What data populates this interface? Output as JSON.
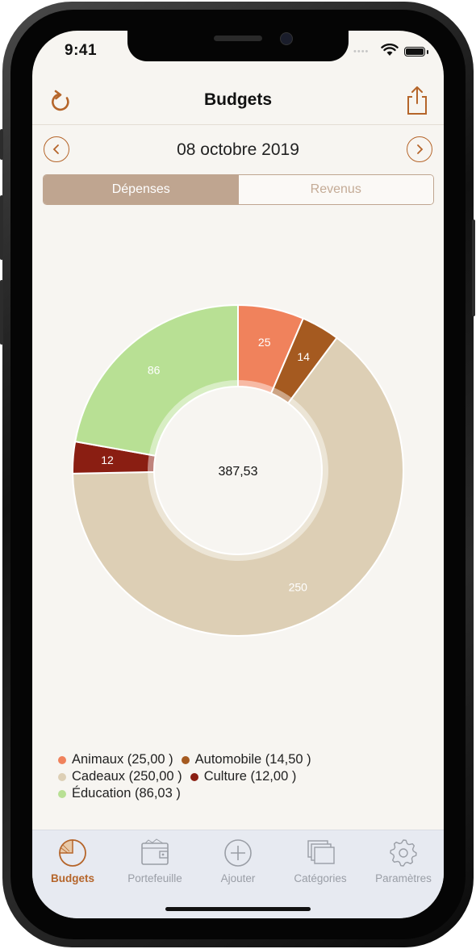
{
  "status_bar": {
    "time": "9:41"
  },
  "navbar": {
    "title": "Budgets",
    "left_icon": "refresh-icon",
    "right_icon": "share-icon"
  },
  "date_nav": {
    "date": "08 octobre 2019",
    "prev_icon": "chevron-left-icon",
    "next_icon": "chevron-right-icon"
  },
  "segment": {
    "options": [
      "Dépenses",
      "Revenus"
    ],
    "selected": "Dépenses"
  },
  "colors": {
    "accent": "#b5652a",
    "segment_active": "#bfa590",
    "background": "#f7f5f1"
  },
  "chart_data": {
    "type": "pie",
    "center_label": "387,53",
    "slices": [
      {
        "label": "25",
        "value": 25.0,
        "color": "#f0825c"
      },
      {
        "label": "14",
        "value": 14.5,
        "color": "#a55a20"
      },
      {
        "label": "250",
        "value": 250.0,
        "color": "#ddcfb5"
      },
      {
        "label": "12",
        "value": 12.0,
        "color": "#8a1e12"
      },
      {
        "label": "86",
        "value": 86.03,
        "color": "#b8e094"
      }
    ]
  },
  "legend": [
    {
      "text": "Animaux (25,00 )",
      "color": "#f0825c"
    },
    {
      "text": "Automobile (14,50 )",
      "color": "#a55a20"
    },
    {
      "text": "Cadeaux (250,00 )",
      "color": "#ddcfb5"
    },
    {
      "text": "Culture (12,00 )",
      "color": "#8a1e12"
    },
    {
      "text": "Éducation (86,03 )",
      "color": "#b8e094"
    }
  ],
  "tabbar": {
    "items": [
      {
        "label": "Budgets",
        "icon": "pie-chart-icon",
        "active": true
      },
      {
        "label": "Portefeuille",
        "icon": "wallet-icon",
        "active": false
      },
      {
        "label": "Ajouter",
        "icon": "add-circle-icon",
        "active": false
      },
      {
        "label": "Catégories",
        "icon": "stacked-folders-icon",
        "active": false
      },
      {
        "label": "Paramètres",
        "icon": "gear-icon",
        "active": false
      }
    ]
  }
}
